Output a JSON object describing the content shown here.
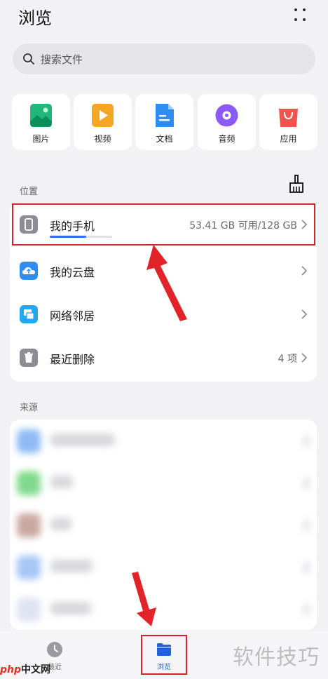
{
  "header": {
    "title": "浏览",
    "more_icon": "more-dots-icon"
  },
  "search": {
    "placeholder": "搜索文件",
    "icon": "search-icon"
  },
  "categories": [
    {
      "label": "图片",
      "icon": "image-icon",
      "color": "#1fb77a"
    },
    {
      "label": "视频",
      "icon": "video-icon",
      "color": "#f5a623"
    },
    {
      "label": "文档",
      "icon": "document-icon",
      "color": "#2f8cf0"
    },
    {
      "label": "音频",
      "icon": "audio-icon",
      "color": "#8a5cf5"
    },
    {
      "label": "应用",
      "icon": "app-icon",
      "color": "#f0544c"
    }
  ],
  "location": {
    "section_label": "位置",
    "clean_icon": "broom-icon",
    "items": [
      {
        "label": "我的手机",
        "meta": "53.41 GB 可用/128 GB",
        "icon": "phone-icon",
        "color": "#8c8c94",
        "storage_used_fraction": 0.58
      },
      {
        "label": "我的云盘",
        "meta": "",
        "icon": "cloud-icon",
        "color": "#2f8cf0"
      },
      {
        "label": "网络邻居",
        "meta": "",
        "icon": "network-icon",
        "color": "#22a7f0"
      },
      {
        "label": "最近删除",
        "meta": "4 项",
        "icon": "trash-icon",
        "color": "#8c8c94"
      }
    ]
  },
  "sources": {
    "section_label": "来源"
  },
  "bottom_nav": {
    "items": [
      {
        "label": "最近",
        "icon": "clock-icon",
        "active": false
      },
      {
        "label": "浏览",
        "icon": "folder-icon",
        "active": true
      }
    ]
  },
  "watermark": {
    "text": "软件技巧"
  },
  "logo": {
    "php": "php",
    "cn": "中文网"
  },
  "colors": {
    "accent": "#2f6ee6",
    "highlight": "#d6222c"
  }
}
